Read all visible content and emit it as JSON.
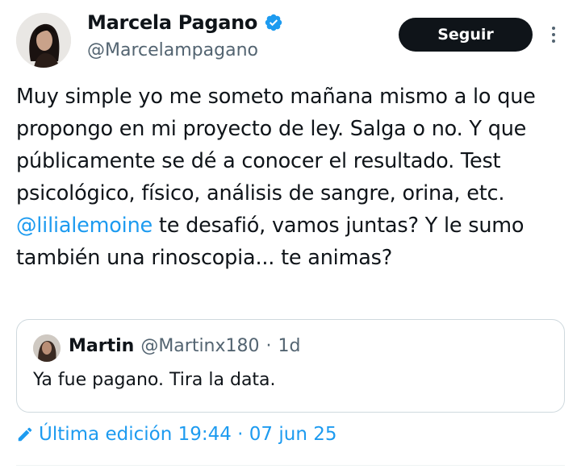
{
  "author": {
    "name": "Marcela Pagano",
    "handle": "@Marcelampagano"
  },
  "follow_label": "Seguir",
  "tweet": {
    "part1": "Muy simple yo me someto mañana mismo a lo que propongo en mi proyecto de ley. Salga o no. Y que públicamente se dé a conocer el resultado. Test psicológico, físico, análisis de sangre, orina, etc. ",
    "mention": "@lilialemoine",
    "part2": " te desafió, vamos juntas? Y le sumo también una rinoscopia... te animas?"
  },
  "quote": {
    "name": "Martin",
    "handle": "@Martinx180",
    "separator": "·",
    "time": "1d",
    "text": "Ya fue pagano. Tira la data."
  },
  "edit_info": "Última edición 19:44 · 07 jun 25",
  "colors": {
    "accent": "#1d9bf0",
    "text": "#0f1419",
    "secondary": "#536471",
    "button_bg": "#0f1419"
  },
  "icons": [
    "verified-badge-icon",
    "more-options-icon",
    "pencil-edit-icon"
  ]
}
